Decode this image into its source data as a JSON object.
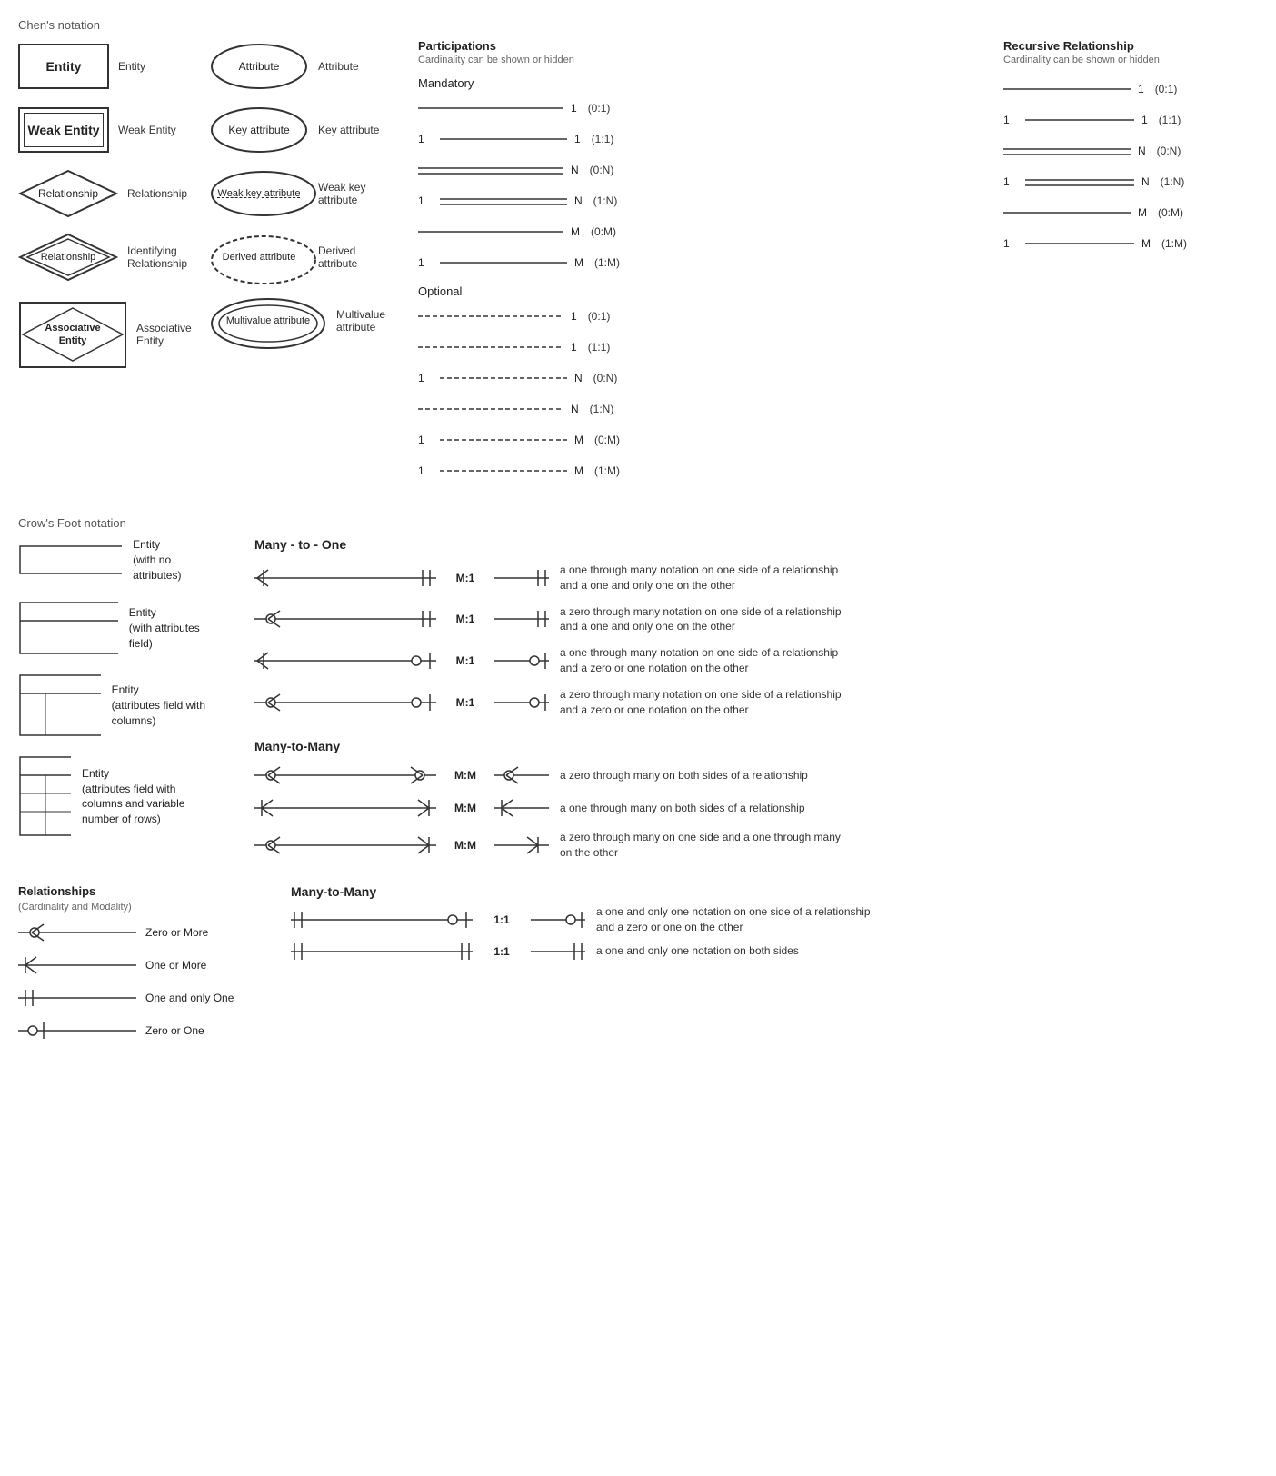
{
  "chens": {
    "title": "Chen's notation",
    "left_items": [
      {
        "shape": "entity",
        "label": "Entity"
      },
      {
        "shape": "weak_entity",
        "label": "Weak Entity"
      },
      {
        "shape": "relationship",
        "label": "Relationship"
      },
      {
        "shape": "id_relationship",
        "label": "Identifying Relationship"
      },
      {
        "shape": "assoc_entity",
        "label": "Associative Entity"
      }
    ],
    "middle_items": [
      {
        "shape": "attribute",
        "label": "Attribute",
        "text": "Attribute"
      },
      {
        "shape": "key_attribute",
        "label": "Key attribute",
        "text": "Key attribute"
      },
      {
        "shape": "weak_key_attribute",
        "label": "Weak key attribute",
        "text": "Weak key attribute"
      },
      {
        "shape": "derived_attribute",
        "label": "Derived attribute",
        "text": "Derived attribute"
      },
      {
        "shape": "multivalue_attribute",
        "label": "Multivalue attribute",
        "text": "Multivalue attribute"
      }
    ]
  },
  "participations": {
    "title": "Participations",
    "subtitle": "Cardinality can be shown or hidden",
    "mandatory_title": "Mandatory",
    "mandatory_rows": [
      {
        "left": "",
        "right": "1",
        "code": "(0:1)"
      },
      {
        "left": "1",
        "right": "1",
        "code": "(1:1)"
      },
      {
        "left": "",
        "right": "N",
        "code": "(0:N)"
      },
      {
        "left": "1",
        "right": "N",
        "code": "(1:N)"
      },
      {
        "left": "",
        "right": "M",
        "code": "(0:M)"
      },
      {
        "left": "1",
        "right": "M",
        "code": "(1:M)"
      }
    ],
    "optional_title": "Optional",
    "optional_rows": [
      {
        "left": "",
        "right": "1",
        "code": "(0:1)"
      },
      {
        "left": "",
        "right": "1",
        "code": "(1:1)"
      },
      {
        "left": "1",
        "right": "N",
        "code": "(0:N)"
      },
      {
        "left": "",
        "right": "N",
        "code": "(1:N)"
      },
      {
        "left": "1",
        "right": "M",
        "code": "(0:M)"
      },
      {
        "left": "1",
        "right": "M",
        "code": "(1:M)"
      }
    ]
  },
  "recursive": {
    "title": "Recursive Relationship",
    "subtitle": "Cardinality can be shown or hidden",
    "rows": [
      {
        "left": "",
        "right": "1",
        "code": "(0:1)"
      },
      {
        "left": "1",
        "right": "1",
        "code": "(1:1)"
      },
      {
        "left": "",
        "right": "N",
        "code": "(0:N)"
      },
      {
        "left": "1",
        "right": "N",
        "code": "(1:N)"
      },
      {
        "left": "",
        "right": "M",
        "code": "(0:M)"
      },
      {
        "left": "1",
        "right": "M",
        "code": "(1:M)"
      }
    ]
  },
  "crows": {
    "title": "Crow's Foot notation",
    "entities": [
      {
        "label": "Entity\n(with no attributes)"
      },
      {
        "label": "Entity\n(with attributes field)"
      },
      {
        "label": "Entity\n(attributes field with columns)"
      },
      {
        "label": "Entity\n(attributes field with columns and\nvariable number of rows)"
      }
    ],
    "relationships": {
      "title": "Relationships",
      "subtitle": "(Cardinality and Modality)",
      "items": [
        {
          "symbol": "zero_or_more",
          "label": "Zero or More"
        },
        {
          "symbol": "one_or_more",
          "label": "One or More"
        },
        {
          "symbol": "one_only",
          "label": "One and only One"
        },
        {
          "symbol": "zero_or_one",
          "label": "Zero or One"
        }
      ]
    },
    "many_to_one": {
      "title": "Many - to - One",
      "rows": [
        {
          "label": "M:1",
          "desc": "a one through many notation on one side of a relationship and a one and only one on the other"
        },
        {
          "label": "M:1",
          "desc": "a zero through many notation on one side of a relationship and a one and only one on the other"
        },
        {
          "label": "M:1",
          "desc": "a one through many notation on one side of a relationship and a zero or one notation on the other"
        },
        {
          "label": "M:1",
          "desc": "a zero through many notation on one side of a relationship and a zero or one notation on the other"
        }
      ]
    },
    "many_to_many": {
      "title": "Many-to-Many",
      "rows": [
        {
          "label": "M:M",
          "desc": "a zero through many on both sides of a relationship"
        },
        {
          "label": "M:M",
          "desc": "a one through many on both sides of a relationship"
        },
        {
          "label": "M:M",
          "desc": "a zero through many on one side and a one through many on the other"
        }
      ]
    },
    "many_to_many2": {
      "title": "Many-to-Many",
      "rows": [
        {
          "label": "1:1",
          "desc": "a one and only one notation on one side of a relationship and a zero or one on the other"
        },
        {
          "label": "1:1",
          "desc": "a one and only one notation on both sides"
        }
      ]
    }
  }
}
